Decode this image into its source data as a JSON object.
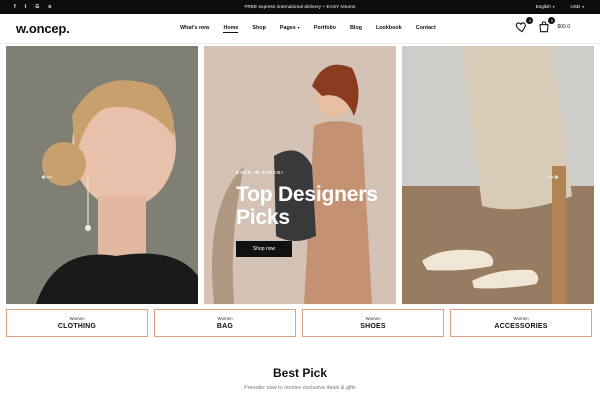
{
  "topbar": {
    "socials": [
      "f",
      "t",
      "G",
      "o"
    ],
    "announcement": "FREE express international delivery + EASY returns",
    "language": "English",
    "currency": "USD"
  },
  "header": {
    "logo": "w.oncep.",
    "nav": [
      {
        "label": "What's new"
      },
      {
        "label": "Home",
        "active": true
      },
      {
        "label": "Shop"
      },
      {
        "label": "Pages",
        "dropdown": true
      },
      {
        "label": "Portfolio"
      },
      {
        "label": "Blog"
      },
      {
        "label": "Lookbook"
      },
      {
        "label": "Contact"
      }
    ],
    "wishlist_count": "0",
    "cart_count": "0",
    "cart_total": "$00.0"
  },
  "hero": {
    "eyebrow": "BACK IN STOCK!",
    "title_line1": "Top Designers",
    "title_line2": "Picks",
    "button": "Shop now"
  },
  "categories": [
    {
      "sub": "Women",
      "main": "CLOTHING"
    },
    {
      "sub": "Women",
      "main": "BAG"
    },
    {
      "sub": "Women",
      "main": "SHOES"
    },
    {
      "sub": "Women",
      "main": "ACCESSORIES"
    }
  ],
  "best_pick": {
    "title": "Best Pick",
    "subtitle": "Preorder now to receive exclusive deals & gifts"
  },
  "colors": {
    "topbar_bg": "#0d0d0d",
    "category_border": "#e0a285",
    "button_bg": "#111111"
  }
}
